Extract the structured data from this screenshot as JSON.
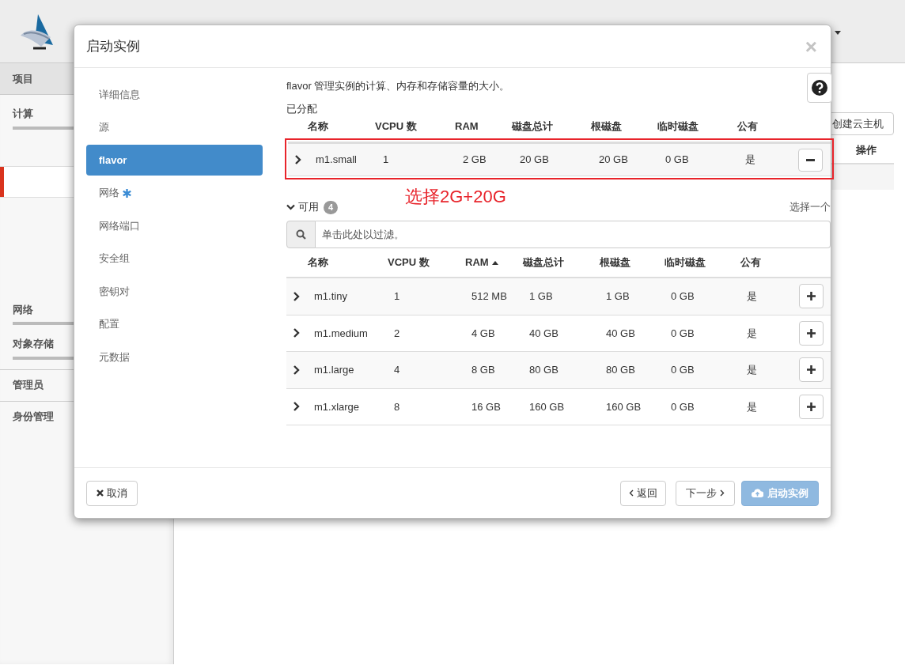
{
  "background": {
    "sidebar": {
      "items": [
        {
          "label": "项目",
          "kind": "panel"
        },
        {
          "label": "计算",
          "kind": "group"
        },
        {
          "label": "网络",
          "kind": "group"
        },
        {
          "label": "对象存储",
          "kind": "group"
        },
        {
          "label": "管理员",
          "kind": "section"
        },
        {
          "label": "身份管理",
          "kind": "section"
        }
      ],
      "has_active_item": true
    },
    "create_button": "创建云主机",
    "table_header": "操作"
  },
  "modal": {
    "title": "启动实例",
    "close": "×",
    "steps": [
      {
        "label": "详细信息",
        "selected": false,
        "required": false
      },
      {
        "label": "源",
        "selected": false,
        "required": false
      },
      {
        "label": "flavor",
        "selected": true,
        "required": false
      },
      {
        "label": "网络",
        "selected": false,
        "required": true
      },
      {
        "label": "网络端口",
        "selected": false,
        "required": false
      },
      {
        "label": "安全组",
        "selected": false,
        "required": false
      },
      {
        "label": "密钥对",
        "selected": false,
        "required": false
      },
      {
        "label": "配置",
        "selected": false,
        "required": false
      },
      {
        "label": "元数据",
        "selected": false,
        "required": false
      }
    ],
    "description": "flavor 管理实例的计算、内存和存储容量的大小。",
    "allocated": {
      "label": "已分配",
      "columns": [
        "名称",
        "VCPU 数",
        "RAM",
        "磁盘总计",
        "根磁盘",
        "临时磁盘",
        "公有"
      ],
      "rows": [
        {
          "name": "m1.small",
          "vcpu": "1",
          "ram": "2 GB",
          "disk_total": "20 GB",
          "root_disk": "20 GB",
          "ephemeral_disk": "0 GB",
          "public": "是"
        }
      ]
    },
    "annotation": {
      "text": "选择2G+20G",
      "color": "#e8242b"
    },
    "available": {
      "label": "可用",
      "count": "4",
      "expanded": true,
      "select_hint": "选择一个",
      "search": {
        "placeholder": "单击此处以过滤。"
      },
      "columns": [
        {
          "label": "名称",
          "sorted": false
        },
        {
          "label": "VCPU 数",
          "sorted": false
        },
        {
          "label": "RAM",
          "sorted": true
        },
        {
          "label": "磁盘总计",
          "sorted": false
        },
        {
          "label": "根磁盘",
          "sorted": false
        },
        {
          "label": "临时磁盘",
          "sorted": false
        },
        {
          "label": "公有",
          "sorted": false
        }
      ],
      "rows": [
        {
          "name": "m1.tiny",
          "vcpu": "1",
          "ram": "512 MB",
          "disk_total": "1 GB",
          "root_disk": "1 GB",
          "ephemeral_disk": "0 GB",
          "public": "是"
        },
        {
          "name": "m1.medium",
          "vcpu": "2",
          "ram": "4 GB",
          "disk_total": "40 GB",
          "root_disk": "40 GB",
          "ephemeral_disk": "0 GB",
          "public": "是"
        },
        {
          "name": "m1.large",
          "vcpu": "4",
          "ram": "8 GB",
          "disk_total": "80 GB",
          "root_disk": "80 GB",
          "ephemeral_disk": "0 GB",
          "public": "是"
        },
        {
          "name": "m1.xlarge",
          "vcpu": "8",
          "ram": "16 GB",
          "disk_total": "160 GB",
          "root_disk": "160 GB",
          "ephemeral_disk": "0 GB",
          "public": "是"
        }
      ]
    },
    "footer": {
      "cancel": "取消",
      "back": "返回",
      "next": "下一步",
      "launch": {
        "label": "启动实例",
        "disabled": true
      }
    }
  }
}
